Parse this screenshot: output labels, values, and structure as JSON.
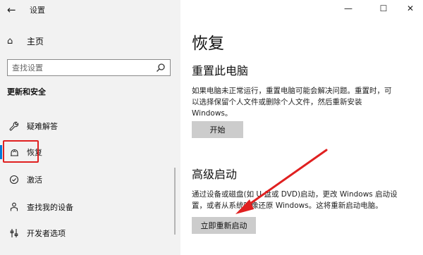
{
  "window": {
    "title": "设置",
    "controls": {
      "minimize": "—",
      "maximize": "☐",
      "close": "✕"
    }
  },
  "sidebar": {
    "home_label": "主页",
    "search_placeholder": "查找设置",
    "section_title": "更新和安全",
    "items": [
      {
        "label": "疑难解答",
        "icon": "wrench-icon"
      },
      {
        "label": "恢复",
        "icon": "recovery-icon",
        "selected": true
      },
      {
        "label": "激活",
        "icon": "check-circle-icon"
      },
      {
        "label": "查找我的设备",
        "icon": "person-location-icon"
      },
      {
        "label": "开发者选项",
        "icon": "developer-tools-icon"
      }
    ]
  },
  "main": {
    "title": "恢复",
    "reset": {
      "heading": "重置此电脑",
      "desc_line1": "如果电脑未正常运行，重置电脑可能会解决问题。重置时，可",
      "desc_line2": "以选择保留个人文件或删除个人文件，然后重新安装",
      "desc_line3": "Windows。",
      "button_label": "开始"
    },
    "advanced": {
      "heading": "高级启动",
      "desc_line1": "通过设备或磁盘(如 U 盘或 DVD)启动，更改 Windows 启动设",
      "desc_line2": "置，或者从系统映像还原 Windows。这将重新启动电脑。",
      "button_label": "立即重新启动"
    }
  },
  "colors": {
    "highlight_box": "#e02020",
    "arrow": "#e02020",
    "selection_accent": "#0078d7"
  }
}
